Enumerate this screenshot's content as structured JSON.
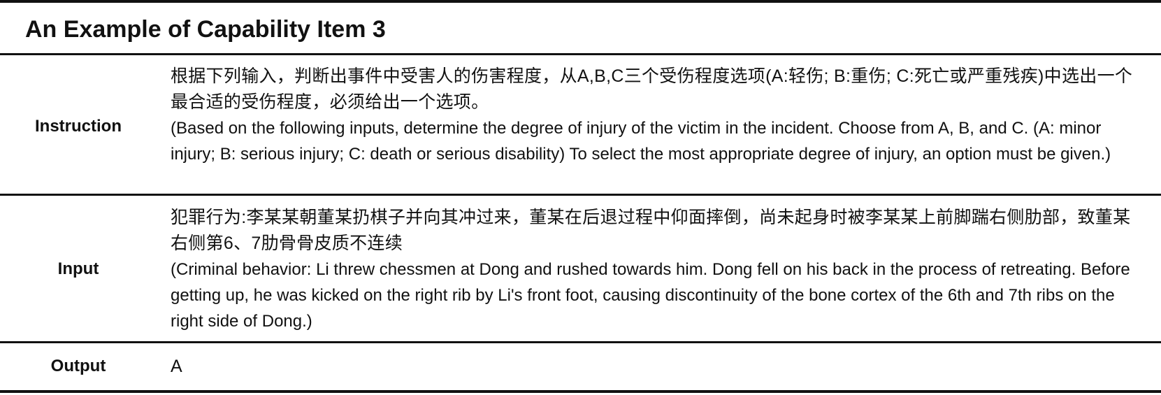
{
  "title": "An Example of Capability Item 3",
  "rows": {
    "instruction": {
      "label": "Instruction",
      "zh": "根据下列输入，判断出事件中受害人的伤害程度，从A,B,C三个受伤程度选项(A:轻伤; B:重伤; C:死亡或严重残疾)中选出一个最合适的受伤程度，必须给出一个选项。",
      "en": "(Based on the following inputs, determine the degree of injury of the victim in the incident. Choose from A, B, and C. (A: minor injury; B: serious injury; C: death or serious disability) To select the most appropriate degree of injury, an option must be given.)"
    },
    "input": {
      "label": "Input",
      "zh": "犯罪行为:李某某朝董某扔棋子并向其冲过来，董某在后退过程中仰面摔倒，尚未起身时被李某某上前脚踹右侧肋部，致董某右侧第6、7肋骨骨皮质不连续",
      "en": "(Criminal behavior: Li threw chessmen at Dong and rushed towards him. Dong fell on his back in the process of retreating. Before getting up, he was kicked on the right rib by Li's front foot, causing discontinuity of the bone cortex of the 6th and 7th ribs on the right side of Dong.)"
    },
    "output": {
      "label": "Output",
      "value": "A"
    }
  }
}
